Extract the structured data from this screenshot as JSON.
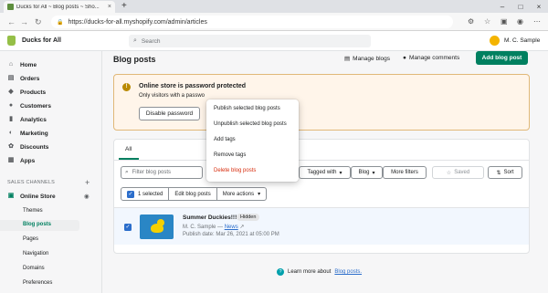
{
  "browser": {
    "tab_title": "Ducks for All ~ Blog posts ~ Sho...",
    "tab_close": "×",
    "new_tab": "+",
    "url": "https://ducks-for-all.myshopify.com/admin/articles",
    "back": "←",
    "forward": "→",
    "reload": "↻",
    "minimize": "–",
    "maximize": "□",
    "close": "×",
    "lock": "🔒"
  },
  "topbar": {
    "store_name": "Ducks for All",
    "search_placeholder": "Search",
    "user_name": "M. C. Sample"
  },
  "sidebar": {
    "items": [
      {
        "label": "Home",
        "icon": "home-icon",
        "glyph": "⌂"
      },
      {
        "label": "Orders",
        "icon": "orders-icon",
        "glyph": "▤"
      },
      {
        "label": "Products",
        "icon": "products-icon",
        "glyph": "◆"
      },
      {
        "label": "Customers",
        "icon": "customers-icon",
        "glyph": "●"
      },
      {
        "label": "Analytics",
        "icon": "analytics-icon",
        "glyph": "▮"
      },
      {
        "label": "Marketing",
        "icon": "marketing-icon",
        "glyph": "◐"
      },
      {
        "label": "Discounts",
        "icon": "discounts-icon",
        "glyph": "✿"
      },
      {
        "label": "Apps",
        "icon": "apps-icon",
        "glyph": "▦"
      }
    ],
    "sales_channels_label": "SALES CHANNELS",
    "add_channel": "+",
    "online_store": "Online Store",
    "online_store_sub": [
      {
        "label": "Themes"
      },
      {
        "label": "Blog posts"
      },
      {
        "label": "Pages"
      },
      {
        "label": "Navigation"
      },
      {
        "label": "Domains"
      },
      {
        "label": "Preferences"
      }
    ]
  },
  "page": {
    "title": "Blog posts",
    "manage_blogs": "Manage blogs",
    "manage_comments": "Manage comments",
    "add_blog_post": "Add blog post"
  },
  "banner": {
    "title": "Online store is password protected",
    "text": "Only visitors with a passwo",
    "button": "Disable password"
  },
  "list": {
    "tab_all": "All",
    "filter_placeholder": "Filter blog posts",
    "tagged_with": "Tagged with",
    "blog": "Blog",
    "more_filters": "More filters",
    "saved": "Saved",
    "sort": "Sort",
    "selected": "1 selected",
    "edit_blog_posts": "Edit blog posts",
    "more_actions": "More actions",
    "post": {
      "title": "Summer Duckies!!!",
      "status": "Hidden",
      "author": "M. C. Sample —",
      "blog_link": "News",
      "date": "Publish date: Mar 26, 2021 at 05:00 PM"
    }
  },
  "more_actions_menu": [
    {
      "label": "Publish selected blog posts"
    },
    {
      "label": "Unpublish selected blog posts"
    },
    {
      "label": "Add tags"
    },
    {
      "label": "Remove tags"
    },
    {
      "label": "Delete blog posts"
    }
  ],
  "footer": {
    "learn_text": "Learn more about",
    "learn_link": "Blog posts."
  },
  "colors": {
    "primary": "#008060",
    "danger": "#d72c0d",
    "link": "#2c6ecb",
    "warning_bg": "#fff5ea"
  }
}
